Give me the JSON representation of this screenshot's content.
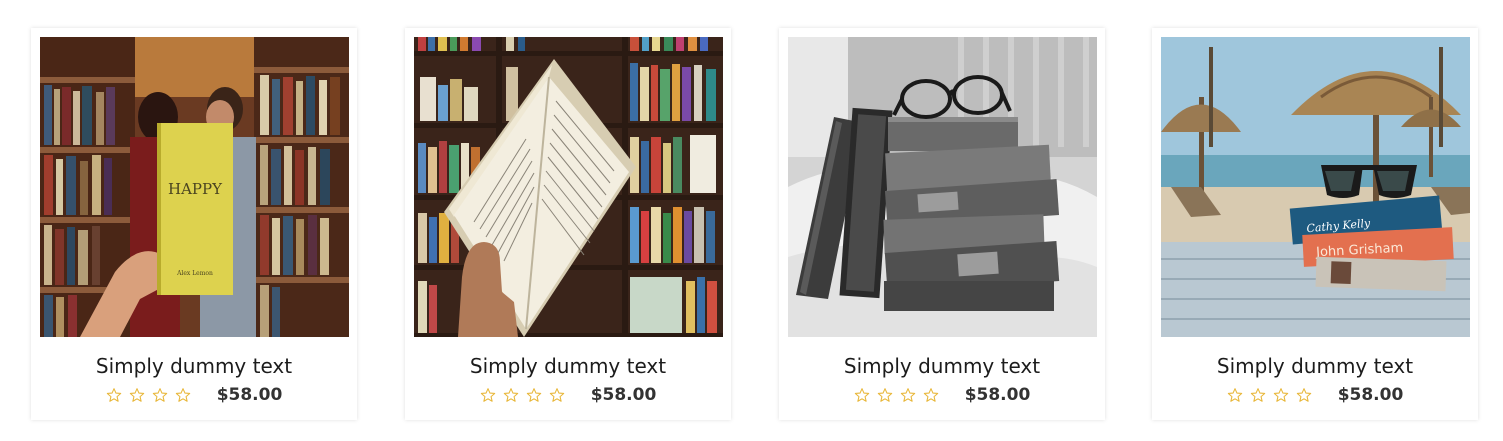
{
  "colors": {
    "star": "#e8b73a",
    "title": "#1c1c1c",
    "price": "#333333"
  },
  "products": [
    {
      "image": "couple-reading-happy-book",
      "cover_title": "HAPPY",
      "cover_author": "Alex Lemon",
      "title": "Simply dummy text",
      "rating": 0,
      "rating_max": 4,
      "price": "$58.00"
    },
    {
      "image": "open-book-held-before-bookshelf",
      "title": "Simply dummy text",
      "rating": 0,
      "rating_max": 4,
      "price": "$58.00"
    },
    {
      "image": "book-stack-with-glasses-bw",
      "title": "Simply dummy text",
      "rating": 0,
      "rating_max": 4,
      "price": "$58.00"
    },
    {
      "image": "beach-books-sunglasses",
      "spine_1": "Cathy Kelly",
      "spine_2": "John Grisham",
      "title": "Simply dummy text",
      "rating": 0,
      "rating_max": 4,
      "price": "$58.00"
    }
  ]
}
